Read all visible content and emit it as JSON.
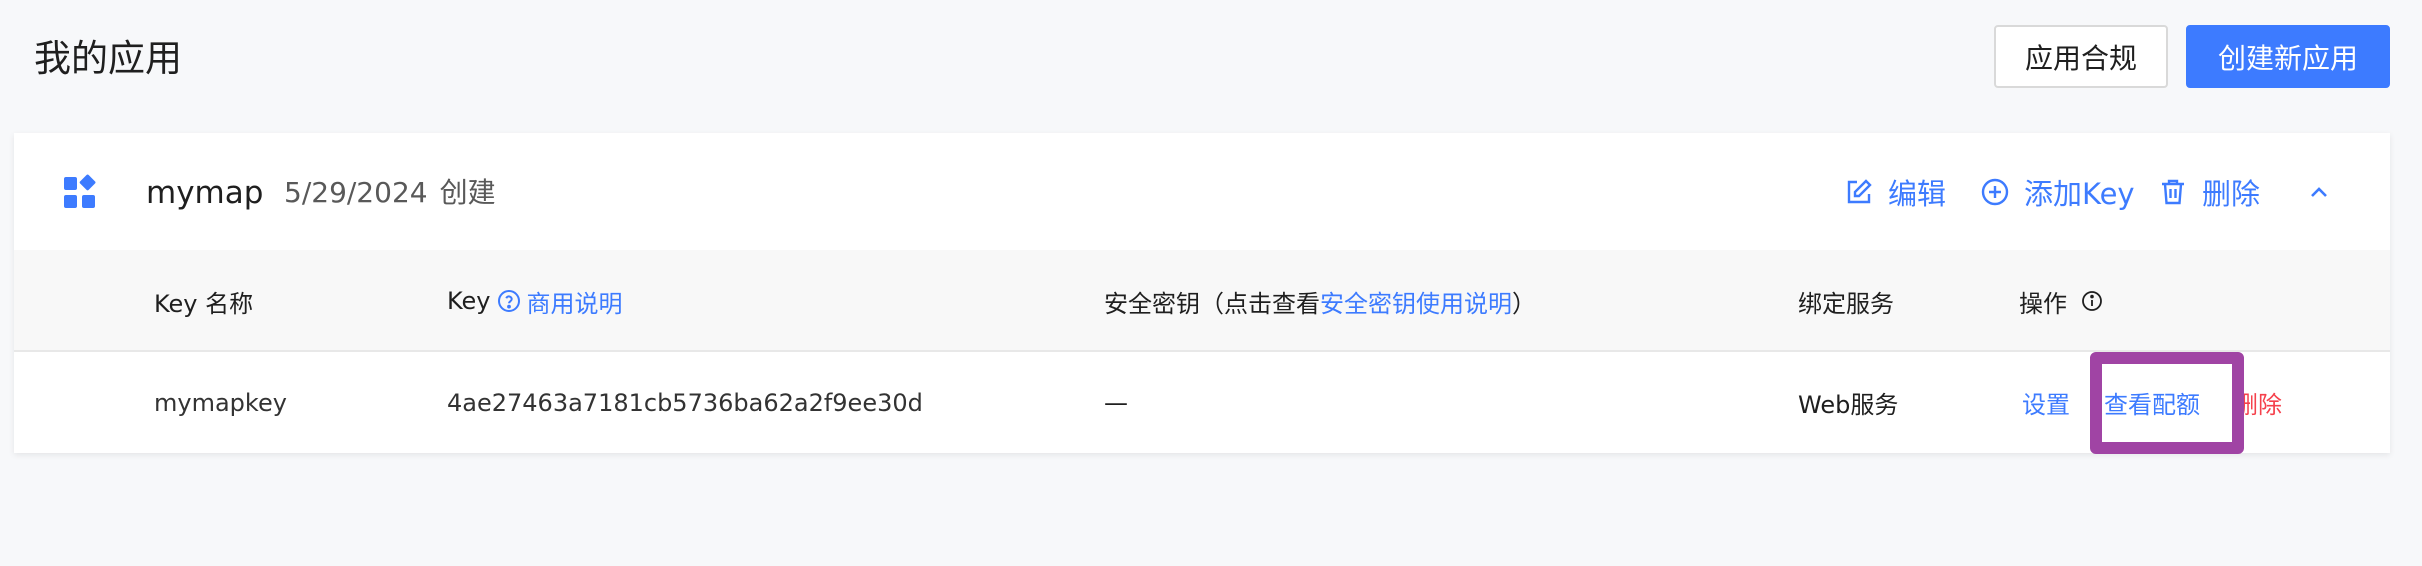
{
  "header": {
    "title": "我的应用",
    "compliance_label": "应用合规",
    "create_label": "创建新应用"
  },
  "app": {
    "name": "mymap",
    "created_date": "5/29/2024",
    "created_suffix": "创建",
    "actions": {
      "edit": "编辑",
      "add_key": "添加Key",
      "delete": "删除"
    }
  },
  "table": {
    "headers": {
      "name": "Key 名称",
      "key": "Key",
      "key_link": "商用说明",
      "secret_prefix": "安全密钥（点击查看",
      "secret_link": "安全密钥使用说明",
      "secret_suffix": "）",
      "service": "绑定服务",
      "ops": "操作"
    },
    "rows": [
      {
        "name": "mymapkey",
        "key": "4ae27463a7181cb5736ba62a2f9ee30d",
        "secret": "—",
        "service": "Web服务",
        "ops": {
          "settings": "设置",
          "view_quota": "查看配额",
          "delete": "删除"
        }
      }
    ]
  },
  "colors": {
    "accent": "#3d7bff",
    "danger": "#f5414c",
    "highlight": "#a044a4"
  },
  "icons": [
    "app-grid-icon",
    "edit-icon",
    "plus-circle-icon",
    "trash-icon",
    "chevron-up-icon",
    "help-circle-icon",
    "info-icon"
  ]
}
